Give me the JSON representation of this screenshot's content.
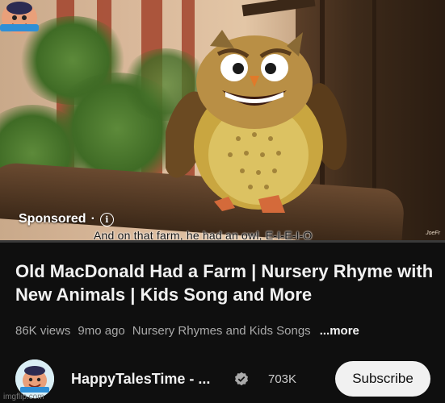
{
  "video": {
    "sponsored_label": "Sponsored",
    "separator": "·",
    "caption": "And on that farm, he had an owl, E-I-E-I-O",
    "progress_fraction": 0.0,
    "progress_color": "#ffcc00"
  },
  "details": {
    "title": "Old MacDonald Had a Farm | Nursery Rhyme with New Animals | Kids Song and More",
    "views": "86K views",
    "age": "9mo ago",
    "channel_tag": "Nursery Rhymes and Kids Songs",
    "more_label": "...more"
  },
  "channel": {
    "name": "HappyTalesTime - ...",
    "subscribers": "703K",
    "subscribe_label": "Subscribe",
    "verified_icon": "verified-badge-icon"
  },
  "watermark": "imgflip.com"
}
